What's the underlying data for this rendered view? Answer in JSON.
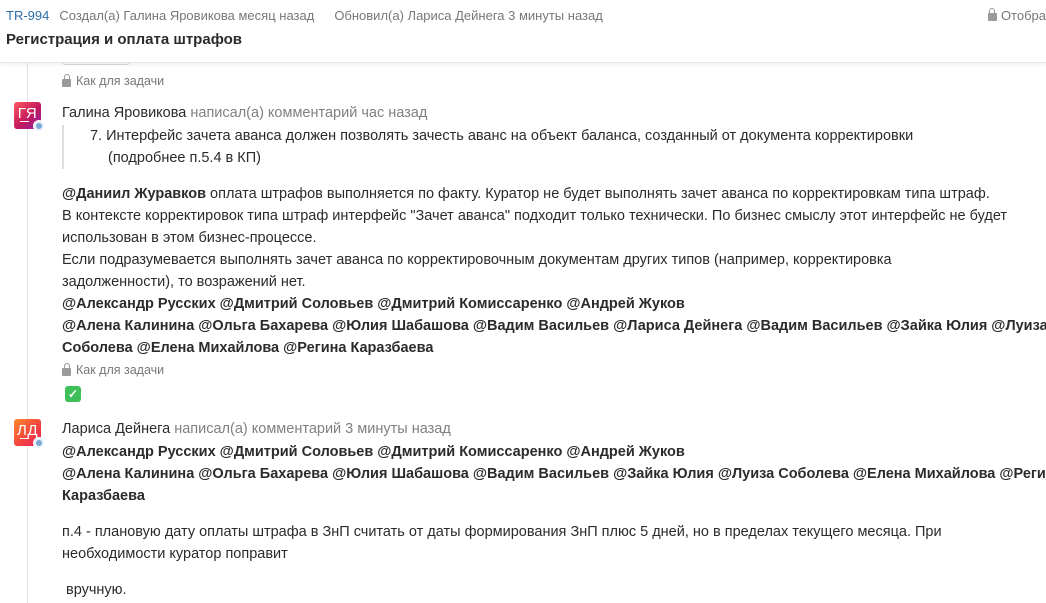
{
  "header": {
    "task_id": "TR-994",
    "created": "Создал(а) Галина Яровикова месяц назад",
    "updated": "Обновил(а) Лариса Дейнега 3 минуты назад",
    "visibility": "Отобра",
    "title": "Регистрация и оплата штрафов"
  },
  "prev_comment": {
    "visibility": "Как для задачи"
  },
  "comments": [
    {
      "initials": "ГЯ",
      "author": "Галина Яровикова",
      "action": "написал(а) комментарий час назад",
      "quote": {
        "number": "7.",
        "line1": "Интерфейс зачета аванса должен позволять зачесть аванс на объект баланса, созданный от документа корректировки",
        "line2": "(подробнее п.5.4 в КП)"
      },
      "mention": "@Даниил Журавков",
      "text1": "оплата штрафов выполняется по факту. Куратор не будет выполнять зачет аванса по корректировкам типа штраф.",
      "text2": "В контексте корректировок типа штраф интерфейс \"Зачет аванса\" подходит только технически. По бизнес смыслу этот интерфейс не будет",
      "text3": "использован в этом бизнес-процессе.",
      "text4": "Если подразумевается выполнять зачет аванса по корректировочным документам других типов (например, корректировка",
      "text5": "задолженности), то возражений нет.",
      "mentions1": "@Александр Русских @Дмитрий Соловьев @Дмитрий Комиссаренко @Андрей Жуков",
      "mentions2": "@Алена Калинина @Ольга Бахарева @Юлия Шабашова @Вадим Васильев @Лариса Дейнега @Вадим Васильев @Зайка Юлия @Луиза",
      "mentions3": "Соболева @Елена Михайлова @Регина Каразбаева",
      "visibility": "Как для задачи",
      "reaction": "✓"
    },
    {
      "initials": "ЛД",
      "author": "Лариса Дейнега",
      "action": "написал(а) комментарий 3 минуты назад",
      "mentions1": "@Александр Русских @Дмитрий Соловьев @Дмитрий Комиссаренко @Андрей Жуков",
      "mentions2": "@Алена Калинина @Ольга Бахарева @Юлия Шабашова @Вадим Васильев @Зайка Юлия @Луиза Соболева @Елена Михайлова @Регина",
      "mentions3": "Каразбаева",
      "text1": "п.4 - плановую дату оплаты штрафа в ЗнП считать от даты формирования ЗнП плюс 5 дней, но в пределах текущего месяца. При",
      "text2": "необходимости куратор поправит",
      "text3": "вручную."
    }
  ]
}
